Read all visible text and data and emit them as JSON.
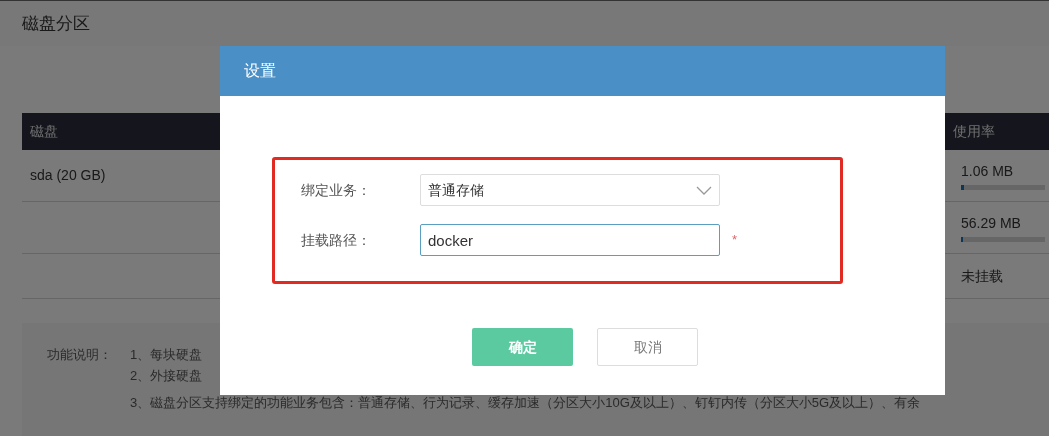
{
  "page_title": "磁盘分区",
  "table": {
    "columns": [
      "磁盘",
      "使用率"
    ],
    "rows": [
      {
        "disk": "sda (20 GB)",
        "usage": "1.06 MB",
        "level": 0.03
      },
      {
        "usage": "56.29 MB",
        "level": 0.01
      },
      {
        "usage": "未挂载"
      }
    ]
  },
  "notes": {
    "label": "功能说明：",
    "lines": [
      "1、每块硬盘",
      "2、外接硬盘",
      "3、磁盘分区支持绑定的功能业务包含：普通存储、行为记录、缓存加速（分区大小10G及以上）、钉钉内传（分区大小5G及以上）、有余"
    ]
  },
  "dialog": {
    "title": "设置",
    "fields": [
      {
        "kind": "select",
        "label": "绑定业务：",
        "value": "普通存储"
      },
      {
        "kind": "input",
        "label": "挂载路径：",
        "value": "docker",
        "required_mark": "*",
        "focused": true
      }
    ],
    "buttons": [
      {
        "label": "确定",
        "primary": true
      },
      {
        "label": "取消",
        "primary": false
      }
    ]
  }
}
